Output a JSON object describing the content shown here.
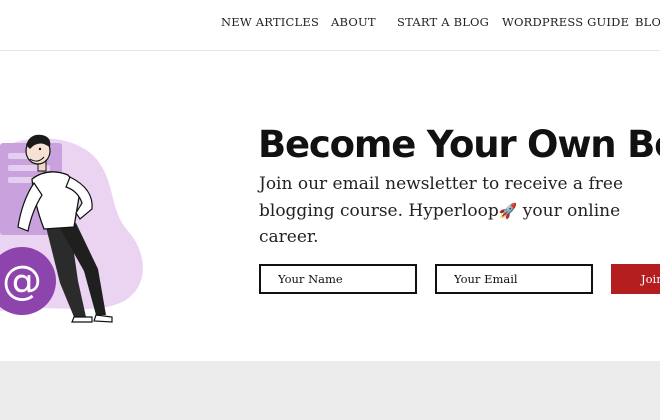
{
  "nav": {
    "items": [
      {
        "label": "NEW ARTICLES"
      },
      {
        "label": "ABOUT"
      },
      {
        "label": "START A BLOG"
      },
      {
        "label": "WORDPRESS GUIDE"
      },
      {
        "label": "BLOG"
      }
    ]
  },
  "hero": {
    "title": "Become Your Own Boss",
    "subtitle_before": "Join our email newsletter to receive a free blogging course. Hyperloop",
    "rocket_emoji": "🚀",
    "subtitle_after": " your online career.",
    "illustration_icon": "at-sign-icon"
  },
  "form": {
    "name_placeholder": "Your Name",
    "email_placeholder": "Your Email",
    "submit_label": "Join"
  },
  "colors": {
    "accent": "#b51e1e",
    "illustration_purple": "#8e44ad",
    "illustration_blob": "#ead4f2",
    "footer_band": "#ececec"
  }
}
